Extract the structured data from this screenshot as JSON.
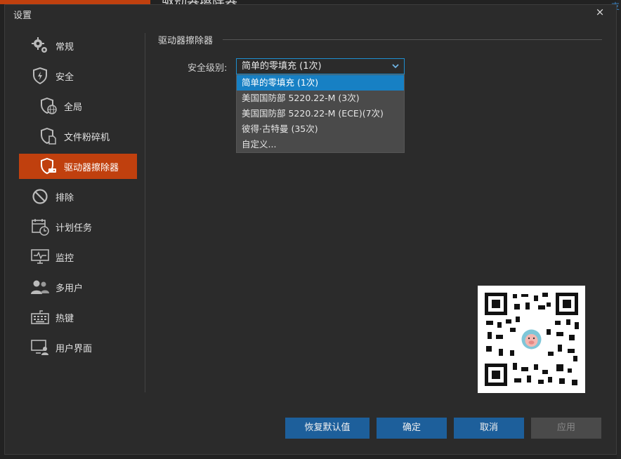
{
  "background": {
    "title_fragment": "驱动器擦除器",
    "right_link": "支"
  },
  "dialog": {
    "title": "设置",
    "close_glyph": "×"
  },
  "sidebar": {
    "items": [
      {
        "label": "常规",
        "icon": "gear-icon"
      },
      {
        "label": "安全",
        "icon": "shield-icon"
      },
      {
        "label": "全局",
        "icon": "shield-globe-icon"
      },
      {
        "label": "文件粉碎机",
        "icon": "shield-file-icon"
      },
      {
        "label": "驱动器擦除器",
        "icon": "shield-drive-icon"
      },
      {
        "label": "排除",
        "icon": "prohibit-icon"
      },
      {
        "label": "计划任务",
        "icon": "calendar-clock-icon"
      },
      {
        "label": "监控",
        "icon": "monitor-pulse-icon"
      },
      {
        "label": "多用户",
        "icon": "users-icon"
      },
      {
        "label": "热键",
        "icon": "keyboard-icon"
      },
      {
        "label": "用户界面",
        "icon": "monitor-user-icon"
      }
    ],
    "active_index": 4
  },
  "main": {
    "section_title": "驱动器擦除器",
    "security_level_label": "安全级别:",
    "security_level_value": "简单的零填充 (1次)",
    "options": [
      "简单的零填充 (1次)",
      "美国国防部 5220.22-M (3次)",
      "美国国防部 5220.22-M (ECE)(7次)",
      "彼得·古特曼 (35次)",
      "自定义..."
    ],
    "selected_option_index": 0
  },
  "buttons": {
    "restore_defaults": "恢复默认值",
    "ok": "确定",
    "cancel": "取消",
    "apply": "应用"
  },
  "colors": {
    "accent_active": "#c0400e",
    "select_border": "#1e8fd0",
    "button_blue": "#1d5f9b"
  }
}
